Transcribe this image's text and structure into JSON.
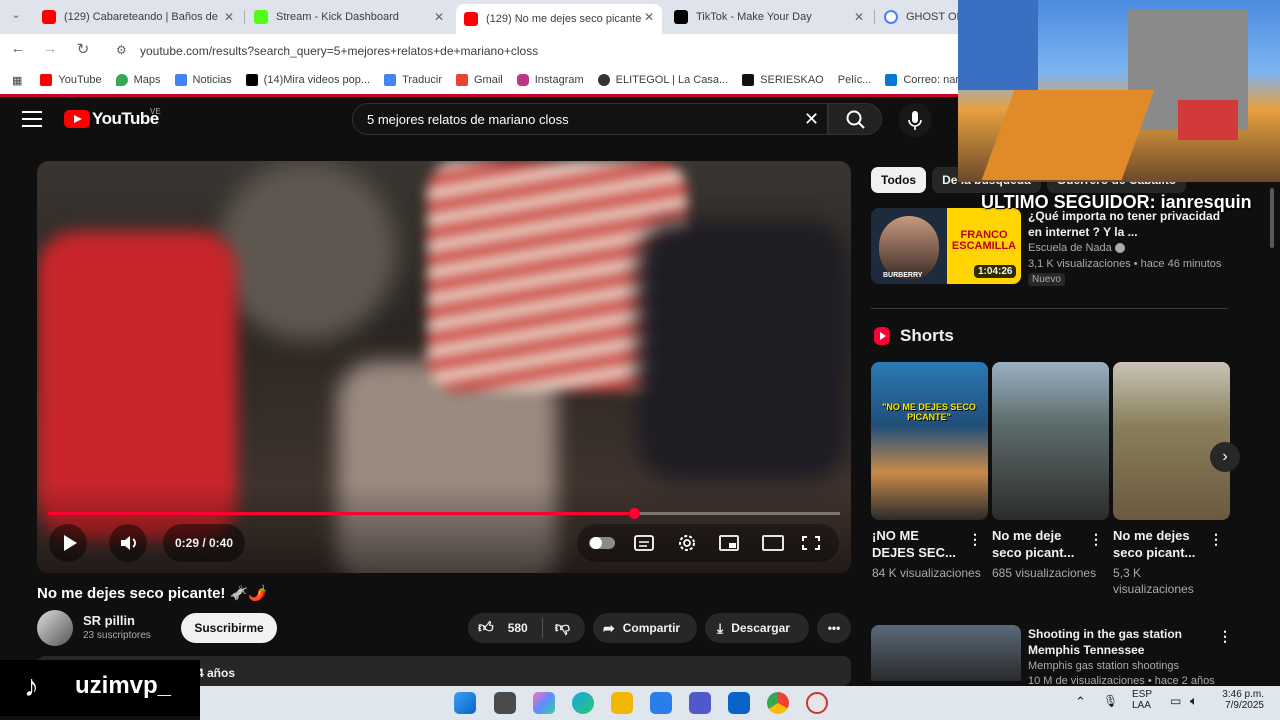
{
  "browser": {
    "tabs": [
      {
        "title": "(129) Cabareteando | Baños de",
        "favicon_color": "#ff0000",
        "active": false
      },
      {
        "title": "Stream - Kick Dashboard",
        "favicon_color": "#53fc18",
        "active": false
      },
      {
        "title": "(129) No me dejes seco picante",
        "favicon_color": "#ff0000",
        "active": true
      },
      {
        "title": "TikTok - Make Your Day",
        "favicon_color": "#000000",
        "active": false
      },
      {
        "title": "GHOST OF",
        "favicon_color": "#4285f4",
        "active": false
      }
    ],
    "url": "youtube.com/results?search_query=5+mejores+relatos+de+mariano+closs",
    "bookmarks": [
      {
        "label": "YouTube",
        "color": "#ff0000"
      },
      {
        "label": "Maps",
        "color": "#34a853"
      },
      {
        "label": "Noticias",
        "color": "#4285f4"
      },
      {
        "label": "(14)Mira videos pop...",
        "color": "#000000"
      },
      {
        "label": "Traducir",
        "color": "#4285f4"
      },
      {
        "label": "Gmail",
        "color": "#ea4335"
      },
      {
        "label": "Instagram",
        "color": "#c13584"
      },
      {
        "label": "ELITEGOL | La Casa...",
        "color": "#333333"
      },
      {
        "label": "SERIESKAO",
        "color": "#111111"
      },
      {
        "label": "Pelíc...",
        "color": "#888888"
      },
      {
        "label": "Correo: nan",
        "color": "#0078d4"
      }
    ]
  },
  "youtube": {
    "logo_text": "YouTube",
    "country_code": "VE",
    "search_query": "5 mejores relatos de mariano closs",
    "player": {
      "current_time": "0:29 / 0:40",
      "progress_fraction": 0.74
    },
    "video": {
      "title": "No me dejes seco picante! 🫏🌶️",
      "channel": "SR pillin",
      "subscribers": "23 suscriptores",
      "subscribe_label": "Suscribirme",
      "likes": "580",
      "share_label": "Compartir",
      "download_label": "Descargar",
      "description_snippet": "4 años"
    },
    "chips": [
      "Todos",
      "De la búsqueda",
      "Guerrero de Cabalito"
    ],
    "rec1": {
      "title": "¿Qué importa no tener privacidad en internet ? Y la ...",
      "channel": "Escuela de Nada",
      "meta": "3,1 K visualizaciones • hace 46 minutos",
      "badge": "Nuevo",
      "duration": "1:04:26",
      "thumb_text": "FRANCO ESCAMILLA",
      "thumb_brand": "BURBERRY"
    },
    "shorts_heading": "Shorts",
    "shorts": [
      {
        "title": "¡NO ME DEJES SEC...",
        "views": "84 K visualizaciones",
        "thumb_text": "\"NO ME DEJES SECO PICANTE\""
      },
      {
        "title": "No me deje seco picant...",
        "views": "685 visualizaciones"
      },
      {
        "title": "No me dejes seco picant...",
        "views": "5,3 K visualizaciones"
      }
    ],
    "rec2": {
      "title": "Shooting in the gas station Memphis Tennessee",
      "channel": "Memphis gas station shootings",
      "meta": "10 M de visualizaciones • hace 2 años"
    }
  },
  "overlay": {
    "last_follower": "ULTIMO SEGUIDOR: ianresquin",
    "tiktok_handle": "uzimvp_"
  },
  "taskbar": {
    "language": "ESP",
    "language_sub": "LAA",
    "time": "3:46 p.m.",
    "date": "7/9/2025"
  }
}
